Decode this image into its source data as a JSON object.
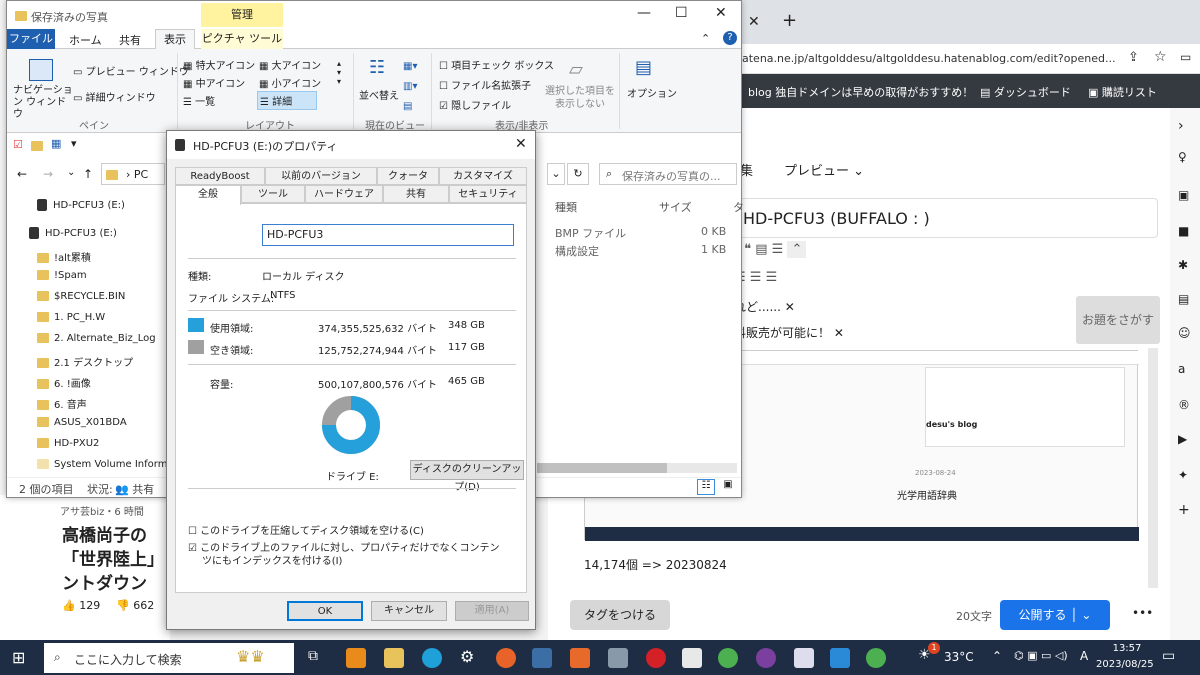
{
  "explorer": {
    "title": "保存済みの写真",
    "manage_tab": "管理",
    "picture_tools_tab": "ピクチャ ツール",
    "tabs": [
      "ファイル",
      "ホーム",
      "共有",
      "表示"
    ],
    "ribbon": {
      "nav_pane": "ナビゲーション ウィンドウ",
      "preview_pane": "プレビュー ウィンドウ",
      "details_pane": "詳細ウィンドウ",
      "group_pane": "ペイン",
      "layout_items": [
        "特大アイコン",
        "大アイコン",
        "中アイコン",
        "小アイコン",
        "一覧",
        "詳細"
      ],
      "group_layout": "レイアウト",
      "sort": "並べ替え",
      "group_view": "現在のビュー",
      "checkboxes": [
        {
          "label": "項目チェック ボックス",
          "checked": false
        },
        {
          "label": "ファイル名拡張子",
          "checked": false
        },
        {
          "label": "隠しファイル",
          "checked": true
        }
      ],
      "hide_selected": "選択した項目を表示しない",
      "options": "オプション",
      "group_show": "表示/非表示"
    },
    "path": "PC",
    "search_placeholder": "保存済みの写真の...",
    "tree_items": [
      "HD-PCFU3 (E:)",
      "HD-PCFU3 (E:)",
      "!alt累積",
      "!Spam",
      "$RECYCLE.BIN",
      "1. PC_H.W",
      "2. Alternate_Biz_Log",
      "2.1 デスクトップ",
      "6. !画像",
      "6. 音声",
      "ASUS_X01BDA",
      "HD-PXU2",
      "System Volume Informati"
    ],
    "columns": {
      "type": "種類",
      "size": "サイズ"
    },
    "files": [
      {
        "type": "BMP ファイル",
        "size": "0 KB"
      },
      {
        "type": "構成設定",
        "size": "1 KB"
      }
    ],
    "status_count": "2 個の項目",
    "status_state": "状況:",
    "status_shared": "共有"
  },
  "dialog": {
    "title": "HD-PCFU3 (E:)のプロパティ",
    "tabs_row1": [
      "ReadyBoost",
      "以前のバージョン",
      "クォータ",
      "カスタマイズ"
    ],
    "tabs_row2": [
      "全般",
      "ツール",
      "ハードウェア",
      "共有",
      "セキュリティ"
    ],
    "name_value": "HD-PCFU3",
    "type_label": "種類:",
    "type_value": "ローカル ディスク",
    "fs_label": "ファイル システム:",
    "fs_value": "NTFS",
    "used_label": "使用領域:",
    "used_bytes": "374,355,525,632 バイト",
    "used_gb": "348 GB",
    "free_label": "空き領域:",
    "free_bytes": "125,752,274,944 バイト",
    "free_gb": "117 GB",
    "cap_label": "容量:",
    "cap_bytes": "500,107,800,576 バイト",
    "cap_gb": "465 GB",
    "used_fraction": 0.749,
    "drive_label": "ドライブ E:",
    "cleanup_button": "ディスクのクリーンアップ(D)",
    "compress_label": "このドライブを圧縮してディスク領域を空ける(C)",
    "compress_checked": false,
    "index_label": "このドライブ上のファイルに対し、プロパティだけでなくコンテンツにもインデックスを付ける(I)",
    "index_checked": true,
    "ok": "OK",
    "cancel": "キャンセル",
    "apply": "適用(A)",
    "colors": {
      "used": "#26a0da",
      "free": "#a0a0a0"
    }
  },
  "browser": {
    "url": "atena.ne.jp/altgolddesu/altgolddesu.hatenablog.com/edit?opened...",
    "notice": "独自ドメインは早めの取得がおすすめ！",
    "blog_tag": "blog",
    "dashboard": "ダッシュボード",
    "reading_list": "購読リスト",
    "edit_tab": "集",
    "preview_tab": "プレビュー",
    "post_title": "HD-PCFU3 (BUFFALO : )",
    "suggest1": "れど......",
    "suggest2": "料販売が可能に！",
    "topic_button": "お題をさがす",
    "embedded_blog": "desu's blog",
    "embedded_date": "2023-08-24",
    "embedded_heading": "光学用語辞典",
    "body_text": "14,174個 => 20230824",
    "tag_button": "タグをつける",
    "char_count": "20文字",
    "publish": "公開する",
    "more": "•••"
  },
  "news": {
    "source": "アサ芸biz・6 時間",
    "headline1": "高橋尚子の",
    "headline2": "「世界陸上」",
    "headline3": "ントダウン",
    "likes": "129",
    "dislikes": "662"
  },
  "taskbar": {
    "search_placeholder": "ここに入力して検索",
    "temperature": "33°C",
    "ime": "A",
    "time": "13:57",
    "date": "2023/08/25",
    "notify_badge": "1"
  }
}
